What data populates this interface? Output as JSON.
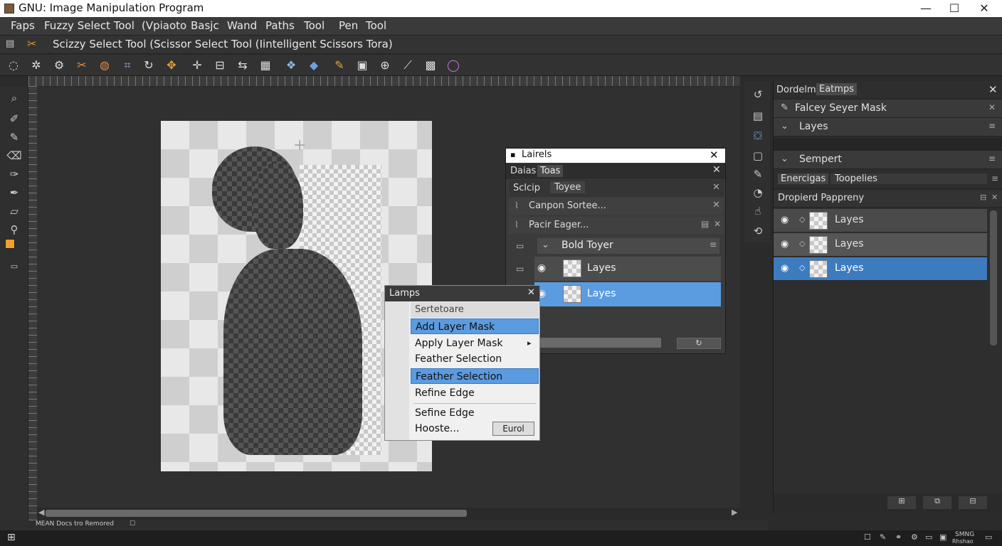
{
  "window": {
    "title": "GNU: Image Manipulation Program",
    "minimize": "—",
    "maximize": "☐",
    "close": "✕"
  },
  "menu": [
    "Faps",
    "Fuzzy Select Tool",
    "(Vpiaoto",
    "Basjc",
    "Wand",
    "Paths",
    "Tool",
    "Pen",
    "Tool"
  ],
  "options": {
    "tool_label": "Scizzy Select Tool (Scissor Select Tool (Iintelligent Scissors Tora)"
  },
  "layers_dialog": {
    "title": "Lairels",
    "tabs": [
      "Daias",
      "Toas"
    ],
    "tabs2": [
      "Sclcip",
      "Toyee"
    ],
    "item1": "Canpon Sortee...",
    "item2": "Pacir Eager...",
    "group": "Bold Toyer",
    "layers": [
      "Layes",
      "Layes"
    ]
  },
  "context_menu": {
    "title": "Lamps",
    "header": "Sertetoare",
    "items": [
      "Add Layer Mask",
      "Apply Layer Mask",
      "Feather Selection",
      "Feather Selection",
      "Refine Edge",
      "Sefine Edge",
      "Hooste..."
    ],
    "button": "Eurol"
  },
  "right_panel": {
    "tabs": [
      "Dordelme",
      "Eatmps"
    ],
    "row1": "Falcey Seyer Mask",
    "row2": "Layes",
    "row3": "Sempert",
    "tabs2": [
      "Enercigas",
      "Toopelies"
    ],
    "section": "Dropierd Pappreny",
    "layers": [
      "Layes",
      "Layes",
      "Layes"
    ]
  },
  "status": {
    "text": "MEAN Docs tro Remored"
  },
  "taskbar": {
    "clock": "SMNG",
    "clock2": "Rhshao"
  },
  "colors": {
    "selection": "#5b9be0",
    "layer_selected": "#3d7bbf",
    "fg": "#f0a030",
    "bg": "#ffffff"
  }
}
